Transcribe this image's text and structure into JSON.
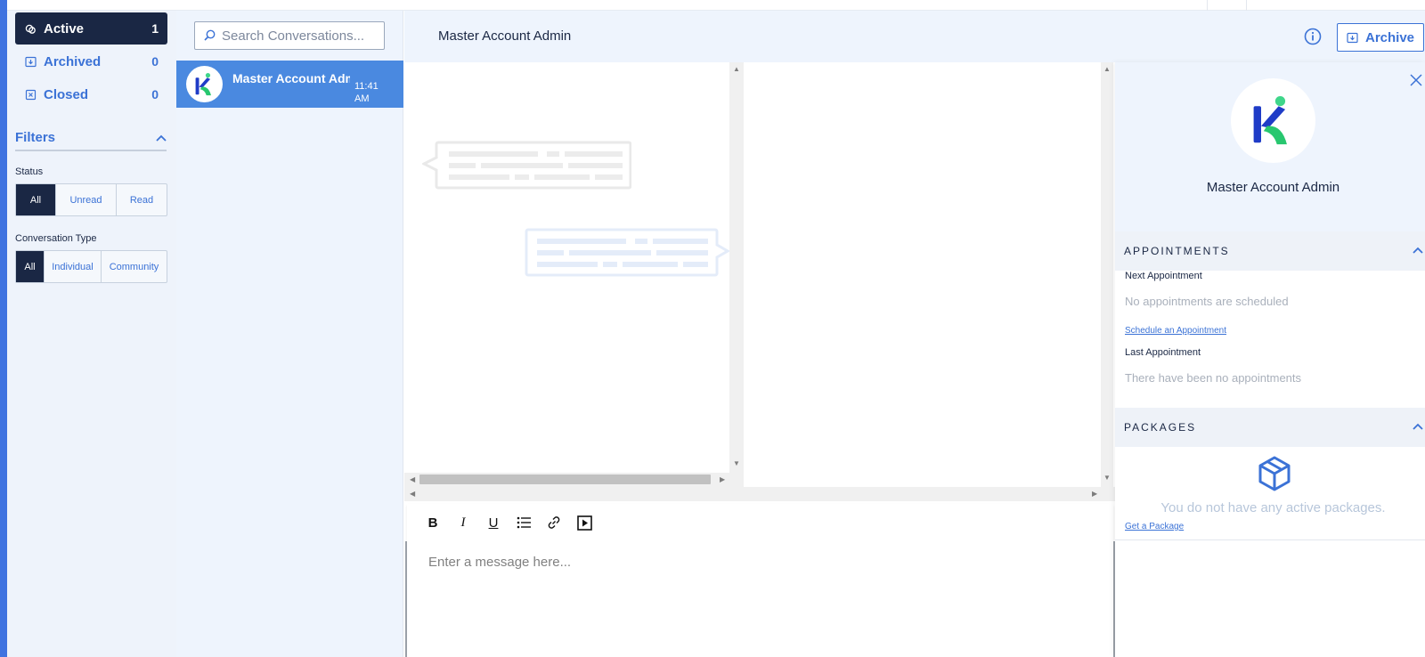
{
  "sidebar": {
    "nav": [
      {
        "label": "Active",
        "count": "1"
      },
      {
        "label": "Archived",
        "count": "0"
      },
      {
        "label": "Closed",
        "count": "0"
      }
    ],
    "filters_title": "Filters",
    "status_label": "Status",
    "status_options": [
      "All",
      "Unread",
      "Read"
    ],
    "type_label": "Conversation Type",
    "type_options": [
      "All",
      "Individual",
      "Community"
    ]
  },
  "conversations": {
    "search_placeholder": "Search Conversations...",
    "items": [
      {
        "name": "Master Account Admin",
        "time": "11:41 AM"
      }
    ]
  },
  "main": {
    "title": "Master Account Admin",
    "archive_label": "Archive",
    "editor_placeholder": "Enter a message here...",
    "toolbar": [
      "B",
      "I",
      "U"
    ]
  },
  "profile": {
    "name": "Master Account Admin",
    "appointments_title": "APPOINTMENTS",
    "next_label": "Next Appointment",
    "next_value": "No appointments are scheduled",
    "schedule_link": "Schedule an Appointment",
    "last_label": "Last Appointment",
    "last_value": "There have been no appointments",
    "packages_title": "PACKAGES",
    "packages_empty": "You do not have any active packages.",
    "get_package_link": "Get a Package"
  },
  "colors": {
    "navy": "#1a2744",
    "accent": "#3b72d6",
    "selected_row": "#4a89e0"
  }
}
